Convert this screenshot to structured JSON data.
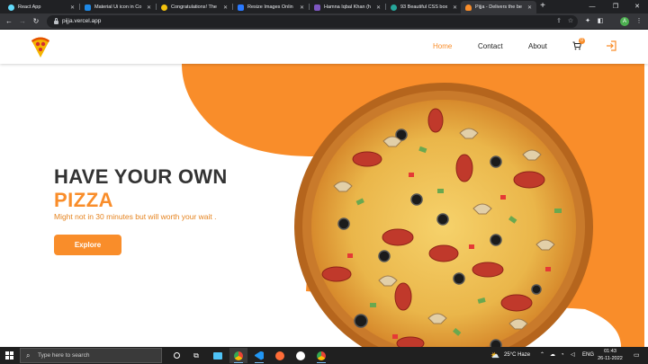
{
  "browser": {
    "tabs": [
      {
        "title": "React App",
        "favicon_color": "#61dafb"
      },
      {
        "title": "Material Ui icon in Co",
        "favicon_color": "#1e88e5"
      },
      {
        "title": "Congratulations! The",
        "favicon_color": "#f4c20d"
      },
      {
        "title": "Resize Images Onlin",
        "favicon_color": "#2979ff"
      },
      {
        "title": "Hamna Iqbal Khan (h",
        "favicon_color": "#7e57c2"
      },
      {
        "title": "93 Beautiful CSS box",
        "favicon_color": "#26a69a"
      },
      {
        "title": "Pijja - Delivers the be",
        "favicon_color": "#f98d2a"
      }
    ],
    "active_tab_index": 6,
    "url": "pijja.vercel.app",
    "profile_initial": "A"
  },
  "site": {
    "nav": {
      "home": "Home",
      "contact": "Contact",
      "about": "About",
      "cart_count": "0"
    },
    "hero": {
      "line1": "HAVE YOUR OWN",
      "line2": "PIZZA",
      "subtitle": "Might not in 30 minutes but will worth your wait .",
      "button": "Explore"
    },
    "colors": {
      "accent": "#f98d2a",
      "heading": "#333333"
    }
  },
  "taskbar": {
    "search_placeholder": "Type here to search",
    "weather": "25°C  Haze",
    "language": "ENG",
    "time": "01:43",
    "date": "26-11-2022"
  }
}
